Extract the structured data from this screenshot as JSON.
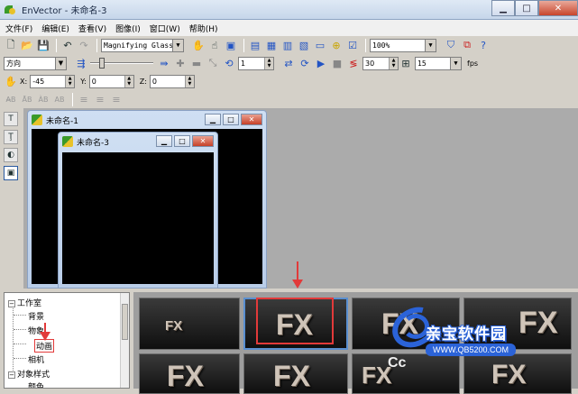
{
  "window": {
    "title": "EnVector - 未命名-3"
  },
  "menu": [
    "文件(F)",
    "编辑(E)",
    "查看(V)",
    "图像(I)",
    "窗口(W)",
    "帮助(H)"
  ],
  "toolbar1": {
    "tool_select": "Magnifying Glass",
    "zoom": "100%"
  },
  "toolbar2": {
    "direction": "方向",
    "frame": "1",
    "fps_value": "30",
    "fps_select": "15",
    "fps_label": "fps"
  },
  "toolbar3": {
    "x_label": "X:",
    "x_value": "-45",
    "y_label": "Y:",
    "y_value": "0",
    "z_label": "Z:",
    "z_value": "0"
  },
  "documents": [
    {
      "title": "未命名-1"
    },
    {
      "title": "未命名-3"
    }
  ],
  "tree": {
    "root": "工作室",
    "items": [
      "背景",
      "物象",
      "动画",
      "相机"
    ],
    "selected": "动画",
    "group2": "对象样式",
    "group2_items": [
      "颜色"
    ]
  },
  "gallery": {
    "thumbnails": [
      "FX",
      "FX",
      "FX",
      "FX",
      "FX",
      "FX",
      "FX",
      "FX"
    ],
    "selected_index": 1
  },
  "watermark": {
    "brand": "亲宝软件园",
    "url": "WWW.QB5200.COM",
    "cc": "Cc"
  },
  "colors": {
    "accent_red": "#e23a3a",
    "workspace": "#ababab",
    "selection_blue": "#5a8fd0"
  }
}
